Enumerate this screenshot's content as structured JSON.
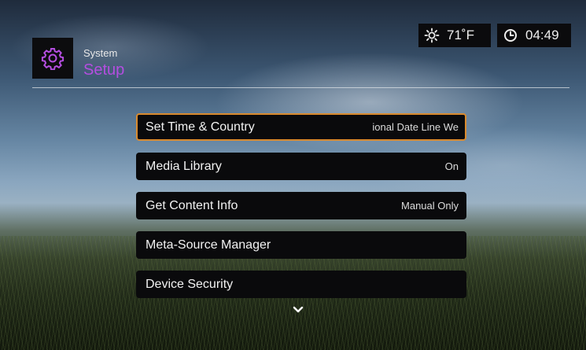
{
  "header": {
    "subtitle": "System",
    "title": "Setup",
    "icon": "gear-icon",
    "accent_color": "#b44ee0"
  },
  "status": {
    "weather_icon": "sun-icon",
    "temperature": "71˚F",
    "clock_icon": "clock-icon",
    "time": "04:49"
  },
  "menu": {
    "items": [
      {
        "label": "Set Time & Country",
        "value": "ional Date Line We",
        "selected": true
      },
      {
        "label": "Media Library",
        "value": "On"
      },
      {
        "label": "Get Content Info",
        "value": "Manual Only"
      },
      {
        "label": "Meta-Source Manager",
        "value": ""
      },
      {
        "label": "Device Security",
        "value": ""
      }
    ],
    "highlight_color": "#d98a2e",
    "more_icon": "chevron-down-icon"
  }
}
